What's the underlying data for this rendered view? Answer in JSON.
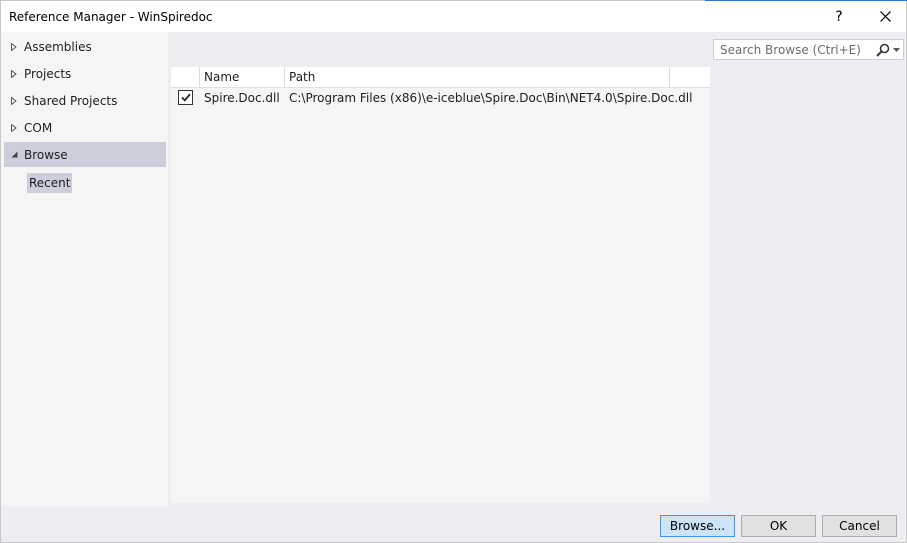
{
  "window": {
    "title": "Reference Manager - WinSpiredoc",
    "help_label": "?",
    "close_label": "✕"
  },
  "sidebar": {
    "items": [
      {
        "label": "Assemblies",
        "expanded": false
      },
      {
        "label": "Projects",
        "expanded": false
      },
      {
        "label": "Shared Projects",
        "expanded": false
      },
      {
        "label": "COM",
        "expanded": false
      },
      {
        "label": "Browse",
        "expanded": true,
        "selected": true
      }
    ],
    "sub_item": "Recent"
  },
  "search": {
    "placeholder": "Search Browse (Ctrl+E)",
    "icon": "search-icon"
  },
  "table": {
    "columns": [
      "Name",
      "Path"
    ],
    "rows": [
      {
        "checked": true,
        "name": "Spire.Doc.dll",
        "path": "C:\\Program Files (x86)\\e-iceblue\\Spire.Doc\\Bin\\NET4.0\\Spire.Doc.dll"
      }
    ]
  },
  "footer": {
    "browse_label": "Browse...",
    "ok_label": "OK",
    "cancel_label": "Cancel"
  },
  "colors": {
    "selection": "#cccedb",
    "accent": "#2b78d4",
    "primary_button": "#cce4f7"
  }
}
